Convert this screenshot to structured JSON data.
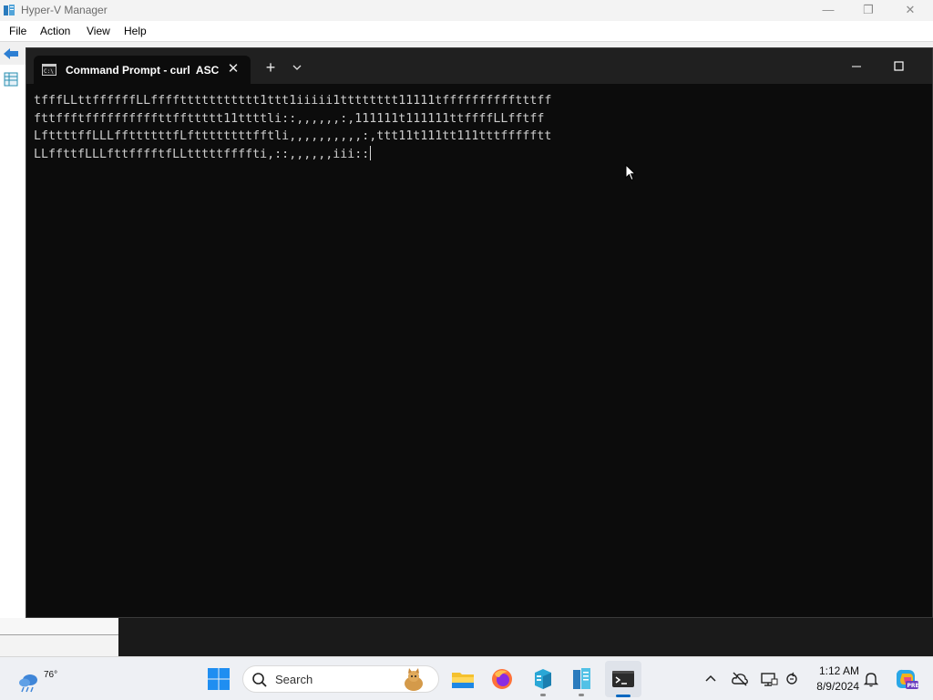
{
  "hyperv": {
    "title": "Hyper-V Manager",
    "menu": [
      "File",
      "Action",
      "View",
      "Help"
    ],
    "controls": {
      "minimize": "—",
      "restore": "❐",
      "close": "✕"
    }
  },
  "terminal": {
    "tab_title": "Command Prompt - curl  ASC",
    "tab_close": "✕",
    "new_tab": "+",
    "output_lines": [
      "tfffLLttffffffLLffffttttttttttt1ttt1iiiii1tttttttt11111tfffffffffftttff",
      "fttffftffffffffffttffttttt11ttttli::,,,,,,:,111111t111111ttffffLLfftff",
      "LfttttffLLLffttttttfLfttttttttfftli,,,,,,,,,,:,ttt11t111tt111tttffffftt",
      "LLffttfLLLfttfffftfLLtttttffffti,::,,,,,,iii::"
    ]
  },
  "taskbar": {
    "weather_temp": "76°",
    "search_placeholder": "Search",
    "clock_time": "1:12 AM",
    "clock_date": "8/9/2024",
    "accent": "#0067c0"
  },
  "icons": [
    "hyperv-app-icon",
    "back-arrow-icon",
    "vm-list-icon",
    "cmd-icon",
    "chevron-down-icon",
    "minimize-icon",
    "maximize-icon",
    "mouse-pointer-icon",
    "weather-icon",
    "windows-start-icon",
    "search-icon",
    "cat-icon",
    "file-explorer-icon",
    "firefox-icon",
    "hyperv-cube-icon",
    "hyperv-manager-icon",
    "terminal-icon",
    "chevron-up-icon",
    "cloud-off-icon",
    "monitor-icon",
    "sync-icon",
    "bell-icon",
    "copilot-icon"
  ]
}
